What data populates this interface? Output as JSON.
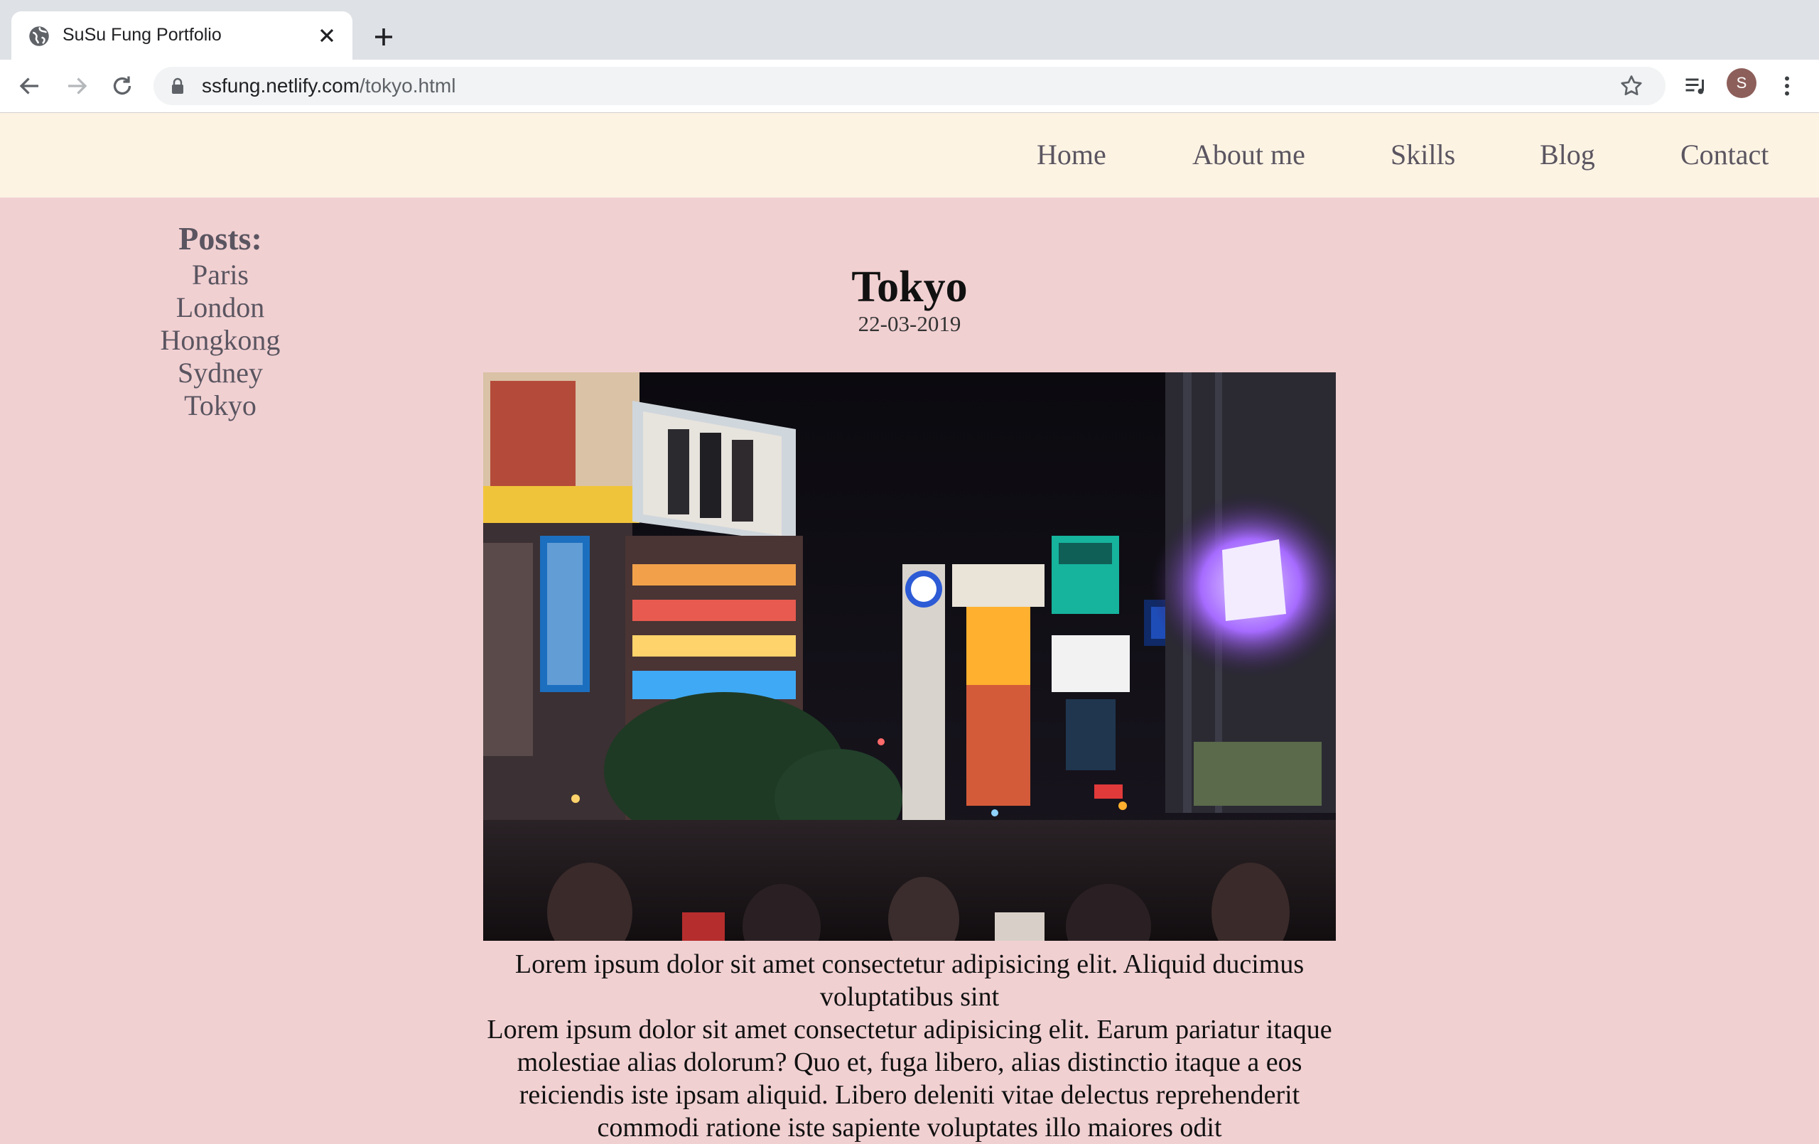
{
  "browser": {
    "tab_title": "SuSu Fung Portfolio",
    "url_domain": "ssfung.netlify.com",
    "url_path": "/tokyo.html",
    "profile_initial": "S",
    "icons": [
      "globe-icon",
      "close-icon",
      "plus-icon",
      "back-arrow-icon",
      "forward-arrow-icon",
      "reload-icon",
      "lock-icon",
      "star-icon",
      "media-queue-icon",
      "more-vert-icon"
    ]
  },
  "nav": {
    "items": [
      {
        "label": "Home"
      },
      {
        "label": "About me"
      },
      {
        "label": "Skills"
      },
      {
        "label": "Blog"
      },
      {
        "label": "Contact"
      }
    ],
    "background": "#fcf3e3"
  },
  "sidebar": {
    "heading": "Posts:",
    "posts": [
      {
        "label": "Paris"
      },
      {
        "label": "London"
      },
      {
        "label": "Hongkong"
      },
      {
        "label": "Sydney"
      },
      {
        "label": "Tokyo"
      }
    ]
  },
  "post": {
    "title": "Tokyo",
    "date": "22-03-2019",
    "image_subject": "Shibuya crossing at night",
    "paragraphs": [
      "Lorem ipsum dolor sit amet consectetur adipisicing elit. Aliquid ducimus voluptatibus sint",
      "Lorem ipsum dolor sit amet consectetur adipisicing elit. Earum pariatur itaque molestiae alias dolorum? Quo et, fuga libero, alias distinctio itaque a eos reiciendis iste ipsam aliquid. Libero deleniti vitae delectus reprehenderit commodi ratione iste sapiente voluptates illo maiores odit"
    ]
  },
  "colors": {
    "page_background": "#f1d0d2",
    "text_muted": "#5a5560"
  }
}
